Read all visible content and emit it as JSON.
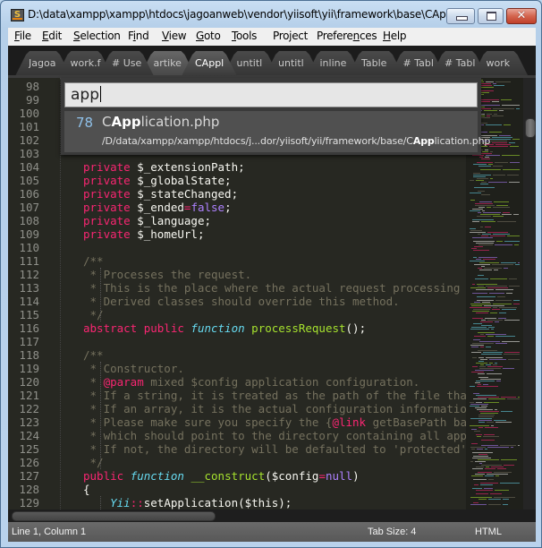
{
  "window": {
    "title": "D:\\data\\xampp\\xampp\\htdocs\\jagoanweb\\vendor\\yiisoft\\yii\\framework\\base\\CAppli...",
    "app_icon": "sublime-text-icon",
    "controls": {
      "minimize": "minimize",
      "maximize": "maximize",
      "close": "✕"
    }
  },
  "menu": [
    {
      "label": "File",
      "mnemonic": "F",
      "rest": "ile"
    },
    {
      "label": "Edit",
      "mnemonic": "E",
      "rest": "dit"
    },
    {
      "label": "Selection",
      "mnemonic": "S",
      "rest": "election"
    },
    {
      "label": "Find",
      "pre": "F",
      "mnemonic": "i",
      "rest": "nd"
    },
    {
      "label": "View",
      "mnemonic": "V",
      "rest": "iew"
    },
    {
      "label": "Goto",
      "mnemonic": "G",
      "rest": "oto"
    },
    {
      "label": "Tools",
      "mnemonic": "T",
      "rest": "ools"
    },
    {
      "label": "Project",
      "pre": "Pro",
      "mnemonic": "j",
      "rest": "ect"
    },
    {
      "label": "Preferences",
      "pre": "Prefere",
      "mnemonic": "n",
      "rest": "ces"
    },
    {
      "label": "Help",
      "mnemonic": "H",
      "rest": "elp"
    }
  ],
  "tabs": [
    {
      "label": "Jagoa",
      "active": false
    },
    {
      "label": "work.f",
      "active": false
    },
    {
      "label": "# Use",
      "active": false
    },
    {
      "label": "artike",
      "active": false
    },
    {
      "label": "CAppl",
      "active": true
    },
    {
      "label": "untitl",
      "active": false
    },
    {
      "label": "untitl",
      "active": false
    },
    {
      "label": "inline",
      "active": false
    },
    {
      "label": "Table",
      "active": false
    },
    {
      "label": "# Tabl",
      "active": false
    },
    {
      "label": "# Tabl",
      "active": false
    },
    {
      "label": "work",
      "active": false
    }
  ],
  "goto_anything": {
    "query": "app",
    "results": [
      {
        "score": "78",
        "title_pre": "C",
        "title_match": "App",
        "title_post": "lication.php",
        "path_pre": "/D/data/xampp/xampp/htdocs/j...dor/yiisoft/yii/framework/base/C",
        "path_match": "App",
        "path_post": "lication.php"
      }
    ]
  },
  "editor": {
    "line_numbers": [
      "98",
      "99",
      "100",
      "101",
      "102",
      "103",
      "104",
      "105",
      "106",
      "107",
      "108",
      "109",
      "110",
      "111",
      "112",
      "113",
      "114",
      "115",
      "116",
      "117",
      "118",
      "119",
      "120",
      "121",
      "122",
      "123",
      "124",
      "125",
      "126",
      "127",
      "128",
      "129"
    ],
    "lines": [
      {
        "n": "104",
        "tokens": [
          {
            "t": "private",
            "c": "kw"
          },
          {
            "t": " $_extensionPath;"
          }
        ]
      },
      {
        "n": "105",
        "tokens": [
          {
            "t": "private",
            "c": "kw"
          },
          {
            "t": " $_globalState;"
          }
        ]
      },
      {
        "n": "106",
        "tokens": [
          {
            "t": "private",
            "c": "kw"
          },
          {
            "t": " $_stateChanged;"
          }
        ]
      },
      {
        "n": "107",
        "tokens": [
          {
            "t": "private",
            "c": "kw"
          },
          {
            "t": " $_ended"
          },
          {
            "t": "=",
            "c": "kw"
          },
          {
            "t": "false",
            "c": "bl"
          },
          {
            "t": ";"
          }
        ]
      },
      {
        "n": "108",
        "tokens": [
          {
            "t": "private",
            "c": "kw"
          },
          {
            "t": " $_language;"
          }
        ]
      },
      {
        "n": "109",
        "tokens": [
          {
            "t": "private",
            "c": "kw"
          },
          {
            "t": " $_homeUrl;"
          }
        ]
      },
      {
        "n": "110",
        "tokens": []
      },
      {
        "n": "111",
        "tokens": [
          {
            "t": "/**",
            "c": "cm"
          }
        ]
      },
      {
        "n": "112",
        "tokens": [
          {
            "t": " * Processes the request.",
            "c": "cm"
          }
        ]
      },
      {
        "n": "113",
        "tokens": [
          {
            "t": " * This is the place where the actual request processing work",
            "c": "cm"
          }
        ]
      },
      {
        "n": "114",
        "tokens": [
          {
            "t": " * Derived classes should override this method.",
            "c": "cm"
          }
        ]
      },
      {
        "n": "115",
        "tokens": [
          {
            "t": " */",
            "c": "cm"
          }
        ]
      },
      {
        "n": "116",
        "tokens": [
          {
            "t": "abstract public",
            "c": "kw"
          },
          {
            "t": " "
          },
          {
            "t": "function",
            "c": "fn"
          },
          {
            "t": " "
          },
          {
            "t": "processRequest",
            "c": "nm"
          },
          {
            "t": "();"
          }
        ]
      },
      {
        "n": "117",
        "tokens": []
      },
      {
        "n": "118",
        "tokens": [
          {
            "t": "/**",
            "c": "cm"
          }
        ]
      },
      {
        "n": "119",
        "tokens": [
          {
            "t": " * Constructor.",
            "c": "cm"
          }
        ]
      },
      {
        "n": "120",
        "tokens": [
          {
            "t": " * ",
            "c": "cm"
          },
          {
            "t": "@param",
            "c": "kw"
          },
          {
            "t": " mixed $config application configuration.",
            "c": "cm"
          }
        ]
      },
      {
        "n": "121",
        "tokens": [
          {
            "t": " * If a string, it is treated as the path of the file that co",
            "c": "cm"
          }
        ]
      },
      {
        "n": "122",
        "tokens": [
          {
            "t": " * If an array, it is the actual configuration information.",
            "c": "cm"
          }
        ]
      },
      {
        "n": "123",
        "tokens": [
          {
            "t": " * Please make sure you specify the {",
            "c": "cm"
          },
          {
            "t": "@link",
            "c": "kw"
          },
          {
            "t": " getBasePath basePa",
            "c": "cm"
          }
        ]
      },
      {
        "n": "124",
        "tokens": [
          {
            "t": " * which should point to the directory containing all applica",
            "c": "cm"
          }
        ]
      },
      {
        "n": "125",
        "tokens": [
          {
            "t": " * If not, the directory will be defaulted to 'protected'.",
            "c": "cm"
          }
        ]
      },
      {
        "n": "126",
        "tokens": [
          {
            "t": " */",
            "c": "cm"
          }
        ]
      },
      {
        "n": "127",
        "tokens": [
          {
            "t": "public",
            "c": "kw"
          },
          {
            "t": " "
          },
          {
            "t": "function",
            "c": "fn"
          },
          {
            "t": " "
          },
          {
            "t": "__construct",
            "c": "nm"
          },
          {
            "t": "($config"
          },
          {
            "t": "=",
            "c": "kw"
          },
          {
            "t": "null",
            "c": "bl"
          },
          {
            "t": ")"
          }
        ]
      },
      {
        "n": "128",
        "tokens": [
          {
            "t": "{"
          }
        ]
      },
      {
        "n": "129",
        "tokens": [
          {
            "t": "    "
          },
          {
            "t": "Yii",
            "c": "ty"
          },
          {
            "t": "::",
            "c": "kw"
          },
          {
            "t": "setApplication($this);"
          }
        ]
      }
    ]
  },
  "status": {
    "position": "Line 1, Column 1",
    "tab_size": "Tab Size: 4",
    "syntax": "HTML"
  },
  "colors": {
    "editor_bg": "#272822",
    "keyword": "#f92672",
    "function": "#66d9ef",
    "name": "#a6e22e",
    "comment": "#75715e",
    "constant": "#ae81ff",
    "result_score": "#8fc0e8"
  }
}
